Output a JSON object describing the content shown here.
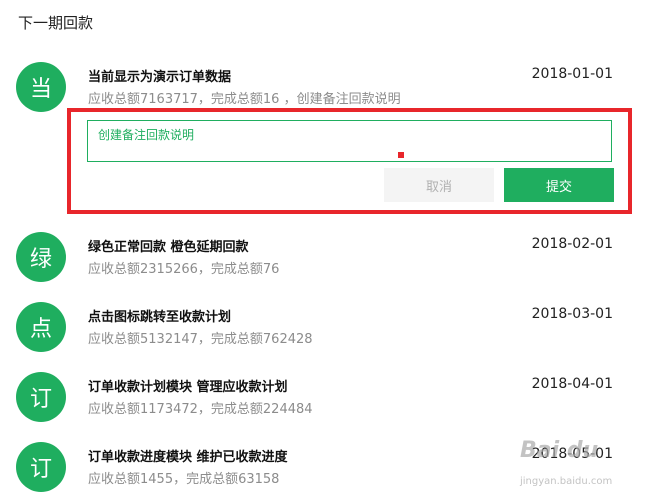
{
  "header": {
    "title": "下一期回款"
  },
  "items": [
    {
      "avatar": "当",
      "title": "当前显示为演示订单数据",
      "sub": "应收总额7163717，完成总额16 ，创建备注回款说明",
      "date": "2018-01-01"
    },
    {
      "avatar": "绿",
      "title": "绿色正常回款 橙色延期回款",
      "sub": "应收总额2315266，完成总额76",
      "date": "2018-02-01"
    },
    {
      "avatar": "点",
      "title": "点击图标跳转至收款计划",
      "sub": "应收总额5132147，完成总额762428",
      "date": "2018-03-01"
    },
    {
      "avatar": "订",
      "title": "订单收款计划模块 管理应收款计划",
      "sub": "应收总额1173472，完成总额224484",
      "date": "2018-04-01"
    },
    {
      "avatar": "订",
      "title": "订单收款进度模块 维护已收款进度",
      "sub": "应收总额1455，完成总额63158",
      "date": "2018-05-01"
    }
  ],
  "note_form": {
    "input_text": "创建备注回款说明",
    "cancel_label": "取消",
    "submit_label": "提交"
  },
  "colors": {
    "accent": "#1fae5f",
    "highlight": "#e8262b"
  },
  "watermark": {
    "text": "Bai du",
    "sub": "jingyan.baidu.com"
  }
}
